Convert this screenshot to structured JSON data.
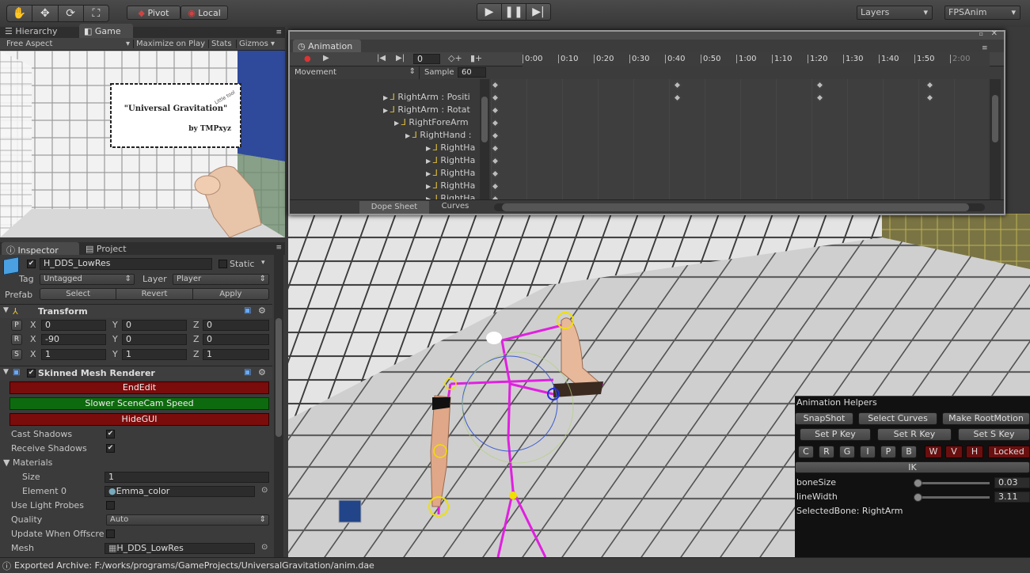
{
  "toolbar": {
    "pivot": "Pivot",
    "local": "Local",
    "layers": "Layers",
    "layout": "FPSAnim"
  },
  "tabs": {
    "hierarchy": "Hierarchy",
    "game": "Game",
    "inspector": "Inspector",
    "project": "Project"
  },
  "game": {
    "aspect": "Free Aspect",
    "maximize": "Maximize on Play",
    "stats": "Stats",
    "gizmos": "Gizmos",
    "poster_title": "\"Universal Gravitation\"",
    "poster_subtitle": "by TMPxyz",
    "poster_note": "Little tool"
  },
  "animation": {
    "title": "Animation",
    "frame": "0",
    "clip": "Movement",
    "sample_label": "Sample",
    "sample_value": "60",
    "ticks": [
      "0:00",
      "0:10",
      "0:20",
      "0:30",
      "0:40",
      "0:50",
      "1:00",
      "1:10",
      "1:20",
      "1:30",
      "1:40",
      "1:50",
      "2:00"
    ],
    "tracks": [
      {
        "label": "RightArm : Positi"
      },
      {
        "label": "RightArm : Rotat"
      },
      {
        "label": "RightForeArm"
      },
      {
        "label": "RightHand :"
      },
      {
        "label": "RightHa"
      },
      {
        "label": "RightHa"
      },
      {
        "label": "RightHa"
      },
      {
        "label": "RightHa"
      },
      {
        "label": "RightHa"
      }
    ],
    "dope_sheet": "Dope Sheet",
    "curves": "Curves"
  },
  "inspector": {
    "object_name": "H_DDS_LowRes",
    "static": "Static",
    "tag_label": "Tag",
    "tag_value": "Untagged",
    "layer_label": "Layer",
    "layer_value": "Player",
    "prefab_label": "Prefab",
    "select": "Select",
    "revert": "Revert",
    "apply": "Apply",
    "transform": {
      "title": "Transform",
      "position": {
        "x": "0",
        "y": "0",
        "z": "0"
      },
      "rotation": {
        "x": "-90",
        "y": "0",
        "z": "0"
      },
      "scale": {
        "x": "1",
        "y": "1",
        "z": "1"
      }
    },
    "smr": {
      "title": "Skinned Mesh Renderer",
      "end_edit": "EndEdit",
      "slower": "Slower SceneCam Speed",
      "hide_gui": "HideGUI",
      "cast_shadows": "Cast Shadows",
      "receive_shadows": "Receive Shadows",
      "materials": "Materials",
      "size_label": "Size",
      "size_value": "1",
      "element0_label": "Element 0",
      "element0_value": "Emma_color",
      "light_probes": "Use Light Probes",
      "quality_label": "Quality",
      "quality_value": "Auto",
      "update_offscreen": "Update When Offscre",
      "mesh_label": "Mesh",
      "mesh_value": "H_DDS_LowRes"
    }
  },
  "helpers": {
    "title": "Animation Helpers",
    "snapshot": "SnapShot",
    "select_curves": "Select Curves",
    "make_root_motion": "Make RootMotion",
    "set_p": "Set P Key",
    "set_r": "Set R Key",
    "set_s": "Set S Key",
    "toggles": [
      "C",
      "R",
      "G",
      "I",
      "P",
      "B",
      "W",
      "V",
      "H"
    ],
    "locked": "Locked",
    "ik": "IK",
    "bone_size_label": "boneSize",
    "bone_size_value": "0.03",
    "line_width_label": "lineWidth",
    "line_width_value": "3.11",
    "selected_bone": "SelectedBone: RightArm"
  },
  "status": {
    "message": "Exported Archive: F:/works/programs/GameProjects/UniversalGravitation/anim.dae"
  }
}
